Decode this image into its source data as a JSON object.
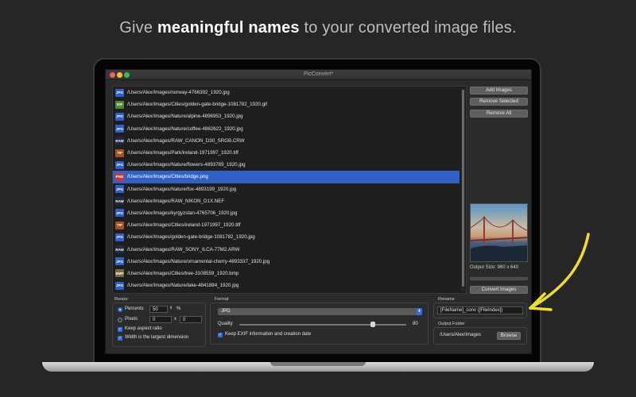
{
  "headline": {
    "prefix": "Give",
    "bold": "meaningful names",
    "suffix": "to your converted image files."
  },
  "window": {
    "title": "PicConvert*"
  },
  "files": [
    {
      "type": "JPG",
      "color": "#2f5fc8",
      "path": "/Users/Alex/Images/norway-4766392_1920.jpg"
    },
    {
      "type": "GIF",
      "color": "#4d8a2f",
      "path": "/Users/Alex/Images/Cities/golden-gate-bridge-1081782_1920.gif"
    },
    {
      "type": "JPG",
      "color": "#2f5fc8",
      "path": "/Users/Alex/Images/Nature/alpine-4896953_1920.jpg"
    },
    {
      "type": "JPG",
      "color": "#2f5fc8",
      "path": "/Users/Alex/Images/Nature/coffee-4862622_1920.jpg"
    },
    {
      "type": "RAW",
      "color": "#1f2a44",
      "path": "/Users/Alex/Images/RAW_CANON_D30_SRGB.CRW"
    },
    {
      "type": "TIF",
      "color": "#a5511f",
      "path": "/Users/Alex/Images/Park/ireland-1971997_1920.tiff"
    },
    {
      "type": "JPG",
      "color": "#2f5fc8",
      "path": "/Users/Alex/Images/Nature/flowers-4893789_1920.jpg"
    },
    {
      "type": "PNG",
      "color": "#c83a3a",
      "path": "/Users/Alex/Images/Cities/bridge.png"
    },
    {
      "type": "JPG",
      "color": "#2f5fc8",
      "path": "/Users/Alex/Images/Nature/fox-4893199_1920.jpg"
    },
    {
      "type": "RAW",
      "color": "#1f2a44",
      "path": "/Users/Alex/Images/RAW_NIKON_D1X.NEF"
    },
    {
      "type": "JPG",
      "color": "#2f5fc8",
      "path": "/Users/Alex/Images/kyrgyzstan-4765706_1920.jpg"
    },
    {
      "type": "TIF",
      "color": "#a5511f",
      "path": "/Users/Alex/Images/Cities/ireland-1971997_1920.tiff"
    },
    {
      "type": "JPG",
      "color": "#2f5fc8",
      "path": "/Users/Alex/Images/golden-gate-bridge-1081782_1920.jpg"
    },
    {
      "type": "RAW",
      "color": "#1f2a44",
      "path": "/Users/Alex/Images/RAW_SONY_ILCA-77M2.ARW"
    },
    {
      "type": "JPG",
      "color": "#2f5fc8",
      "path": "/Users/Alex/Images/Nature/ornamental-cherry-4893337_1920.jpg"
    },
    {
      "type": "BMP",
      "color": "#7a6a3a",
      "path": "/Users/Alex/Images/Cities/tree-3108559_1920.bmp"
    },
    {
      "type": "JPG",
      "color": "#2f5fc8",
      "path": "/Users/Alex/Images/Nature/lake-4841884_1920.jpg"
    }
  ],
  "selected_index": 7,
  "sidebar": {
    "add_images": "Add Images",
    "remove_selected": "Remove Selected",
    "remove_all": "Remove All",
    "output_size": "Output Size: 960 x 640",
    "convert": "Convert Images"
  },
  "resize": {
    "label": "Resize",
    "percents_label": "Percents",
    "percents_value": "50",
    "percent_sign": "%",
    "pixels_label": "Pixels",
    "pixels_w": "0",
    "x_sep": "x",
    "pixels_h": "0",
    "keep_aspect": "Keep aspect ratio",
    "width_largest": "Width is the largest dimension"
  },
  "format": {
    "label": "Format",
    "selected": "JPG",
    "quality_label": "Quality",
    "quality_value": "80",
    "quality_fraction": 0.8,
    "keep_exif": "Keep EXIF information and creation date"
  },
  "rename": {
    "label": "Rename",
    "pattern": "[FileName]_conv ([FileIndex])"
  },
  "output_folder": {
    "label": "Output Folder",
    "path": "/Users/Alex/Images",
    "browse": "Browse"
  },
  "colors": {
    "accent": "#2f6fe4",
    "selection": "#2f62c4",
    "callout_arrow": "#f0e020"
  }
}
